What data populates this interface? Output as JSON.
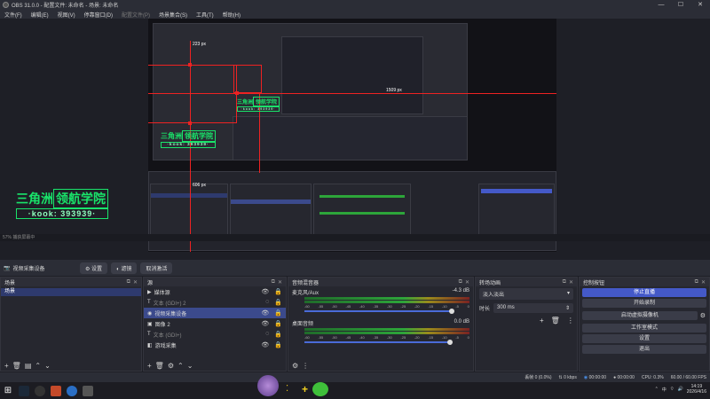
{
  "window": {
    "title": "OBS 31.0.0 - 配置文件: 未命名 - 场景: 未命名"
  },
  "window_controls": {
    "minimize": "—",
    "maximize": "☐",
    "close": "✕"
  },
  "menu": [
    {
      "label": "文件(F)",
      "enabled": true
    },
    {
      "label": "编辑(E)",
      "enabled": true
    },
    {
      "label": "视图(V)",
      "enabled": true
    },
    {
      "label": "停靠窗口(D)",
      "enabled": true
    },
    {
      "label": "配置文件(P)",
      "enabled": false
    },
    {
      "label": "场景集合(S)",
      "enabled": true
    },
    {
      "label": "工具(T)",
      "enabled": true
    },
    {
      "label": "帮助(H)",
      "enabled": true
    }
  ],
  "preview": {
    "labels": {
      "top": "223 px",
      "right": "1509 px",
      "bottom": "606 px"
    },
    "logo": {
      "main": "三角洲",
      "box": "领航学院",
      "sub": "·kook: 393939·"
    },
    "status_text": "57%    捕获屏幕中"
  },
  "properties_bar": {
    "source_name": "视频采集设备",
    "buttons": [
      "设置",
      "滤镜",
      "取消激活"
    ]
  },
  "scenes": {
    "title": "场景",
    "items": [
      "场景"
    ]
  },
  "sources": {
    "title": "源",
    "items": [
      {
        "label": "媒体源",
        "icon": "▶",
        "selected": false,
        "dim": false
      },
      {
        "label": "文本 (GDI+) 2",
        "icon": "T",
        "selected": false,
        "dim": true
      },
      {
        "label": "视频采集设备",
        "icon": "◉",
        "selected": true,
        "dim": false
      },
      {
        "label": "图像 2",
        "icon": "▣",
        "selected": false,
        "dim": false
      },
      {
        "label": "文本 (GDI+)",
        "icon": "T",
        "selected": false,
        "dim": true
      },
      {
        "label": "游戏采集",
        "icon": "◧",
        "selected": false,
        "dim": false
      }
    ]
  },
  "mixer": {
    "title": "音频混音器",
    "channels": [
      {
        "name": "麦克风/Aux",
        "db": "-4.3 dB",
        "volume_pct": 83
      },
      {
        "name": "桌面音频",
        "db": "0.0 dB",
        "volume_pct": 82
      }
    ],
    "ticks": [
      "-60",
      "-55",
      "-50",
      "-45",
      "-40",
      "-35",
      "-30",
      "-25",
      "-20",
      "-15",
      "-10",
      "-5",
      "0"
    ]
  },
  "transitions": {
    "title": "转场动画",
    "selected": "淡入淡出",
    "duration_label": "时长",
    "duration_value": "300 ms"
  },
  "controls": {
    "title": "控制按钮",
    "buttons": [
      {
        "label": "停止直播",
        "active": true
      },
      {
        "label": "开始录制",
        "active": false
      },
      {
        "label": "启动虚拟摄像机",
        "active": false
      },
      {
        "label": "工作室模式",
        "active": false
      },
      {
        "label": "设置",
        "active": false
      },
      {
        "label": "退出",
        "active": false
      }
    ]
  },
  "status": {
    "dropped": "丢帧 0 (0.0%)",
    "bitrate": "0 kbps",
    "stream_time": "00:00:00",
    "rec_time": "00:00:00",
    "cpu": "CPU: 0.3%",
    "fps": "60.00 / 60.00 FPS"
  },
  "taskbar": {
    "time": "14:19",
    "date": "2026/4/16",
    "ime": "中"
  },
  "colors": {
    "accent": "#4459c8",
    "logo_green": "#19e36a",
    "guide_red": "#e22222"
  }
}
